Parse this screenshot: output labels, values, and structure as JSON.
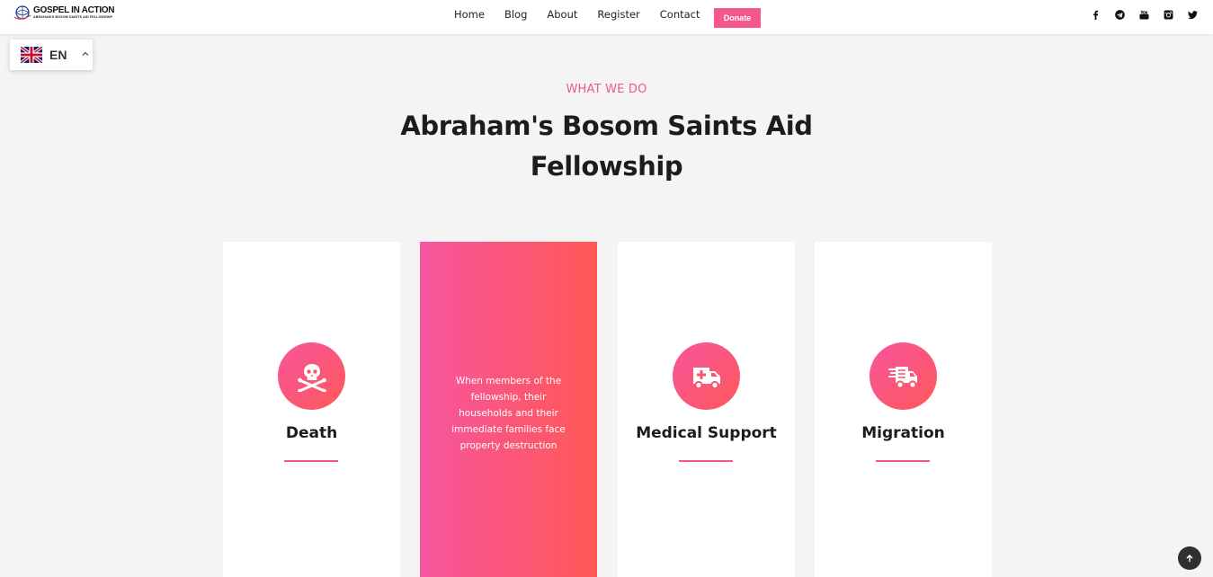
{
  "brand": {
    "title": "GOSPEL IN ACTION",
    "subtitle": "ABRAHAM'S BOSOM SAINTS AID FELLOWSHIP"
  },
  "nav": {
    "items": [
      "Home",
      "Blog",
      "About",
      "Register",
      "Contact"
    ],
    "donate_label": "Donate"
  },
  "social": [
    "facebook-icon",
    "telegram-icon",
    "youtube-icon",
    "instagram-icon",
    "twitter-icon"
  ],
  "language": {
    "code": "EN"
  },
  "section": {
    "eyebrow": "WHAT WE DO",
    "heading": "Abraham's Bosom Saints Aid Fellowship"
  },
  "cards": [
    {
      "title": "Death",
      "icon": "skull-crossbones-icon"
    },
    {
      "description": "When members of the fellowship, their households and their immediate families face property destruction"
    },
    {
      "title": "Medical Support",
      "icon": "ambulance-icon"
    },
    {
      "title": "Migration",
      "icon": "moving-truck-icon"
    }
  ],
  "colors": {
    "accent": "#f5568e",
    "gradient_start": "#f7559f",
    "gradient_end": "#ff5855",
    "background": "#f4f4f4"
  }
}
